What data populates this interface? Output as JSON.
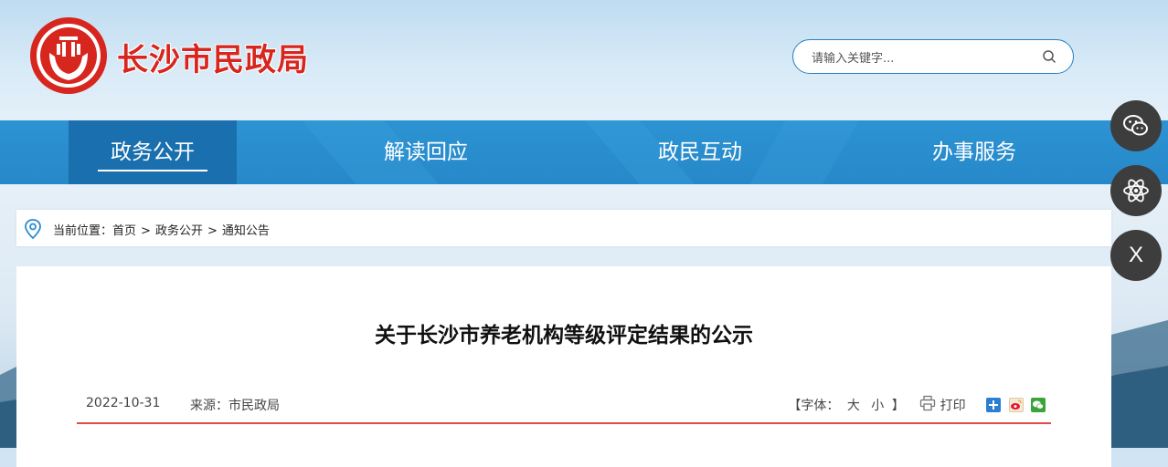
{
  "header": {
    "site_name": "长沙市民政局",
    "search_placeholder": "请输入关键字..."
  },
  "nav": {
    "items": [
      {
        "label": "政务公开",
        "active": true
      },
      {
        "label": "解读回应",
        "active": false
      },
      {
        "label": "政民互动",
        "active": false
      },
      {
        "label": "办事服务",
        "active": false
      }
    ]
  },
  "breadcrumb": {
    "prefix": "当前位置：",
    "items": [
      "首页",
      "政务公开",
      "通知公告"
    ],
    "separator": ">"
  },
  "article": {
    "title": "关于长沙市养老机构等级评定结果的公示",
    "date": "2022-10-31",
    "source_label": "来源：",
    "source": "市民政局",
    "font_label_open": "【字体：",
    "font_large": "大",
    "font_small": "小",
    "font_label_close": "】",
    "print_label": "打印"
  },
  "floating": {
    "close_label": "X"
  },
  "colors": {
    "nav_blue": "#2c93d3",
    "nav_active": "#1a6fae",
    "brand_red": "#d7261e",
    "meta_underline": "#e24a4a"
  }
}
